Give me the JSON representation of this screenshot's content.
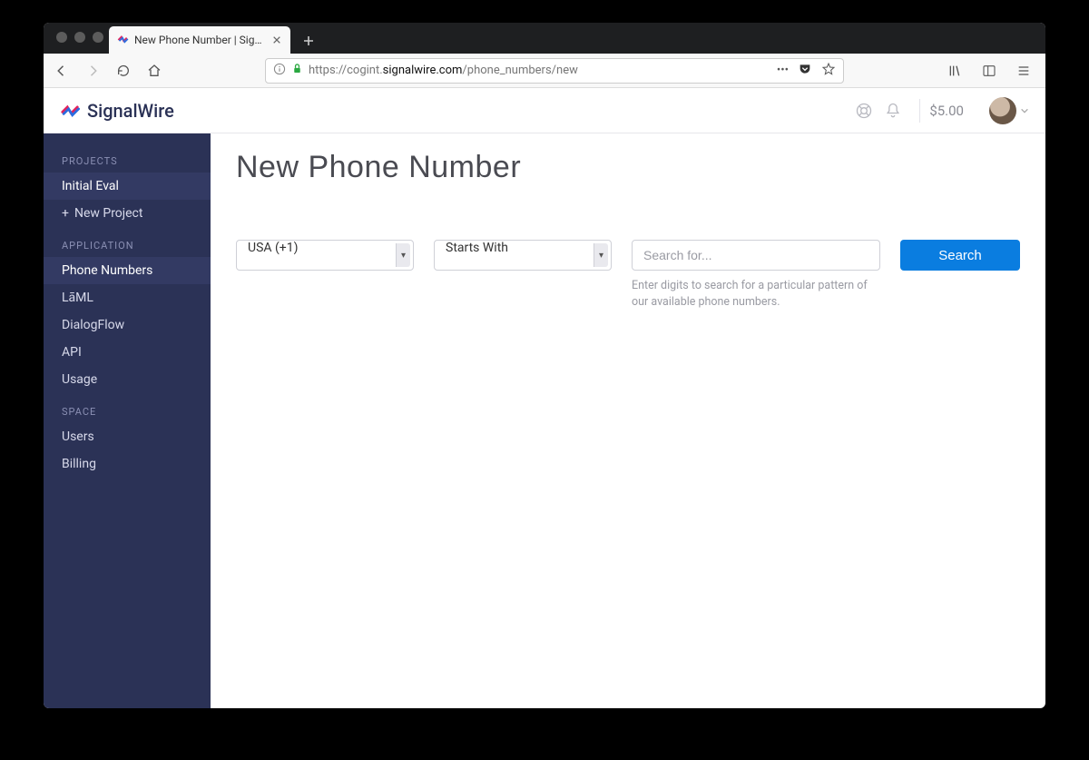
{
  "browser": {
    "tab_title": "New Phone Number | SignalWir",
    "url_prefix": "https://cogint.",
    "url_host": "signalwire.com",
    "url_path": "/phone_numbers/new"
  },
  "brand": {
    "name": "SignalWire"
  },
  "header": {
    "balance": "$5.00"
  },
  "sidebar": {
    "sections": [
      {
        "title": "PROJECTS",
        "items": [
          {
            "label": "Initial Eval",
            "active": true
          },
          {
            "label": "New Project",
            "plus": true
          }
        ]
      },
      {
        "title": "APPLICATION",
        "items": [
          {
            "label": "Phone Numbers",
            "active": true
          },
          {
            "label": "LāML"
          },
          {
            "label": "DialogFlow"
          },
          {
            "label": "API"
          },
          {
            "label": "Usage"
          }
        ]
      },
      {
        "title": "SPACE",
        "items": [
          {
            "label": "Users"
          },
          {
            "label": "Billing"
          }
        ]
      }
    ]
  },
  "page": {
    "title": "New Phone Number",
    "country_select": "USA (+1)",
    "match_select": "Starts With",
    "search_placeholder": "Search for...",
    "help_text": "Enter digits to search for a particular pattern of our available phone numbers.",
    "search_button": "Search"
  }
}
